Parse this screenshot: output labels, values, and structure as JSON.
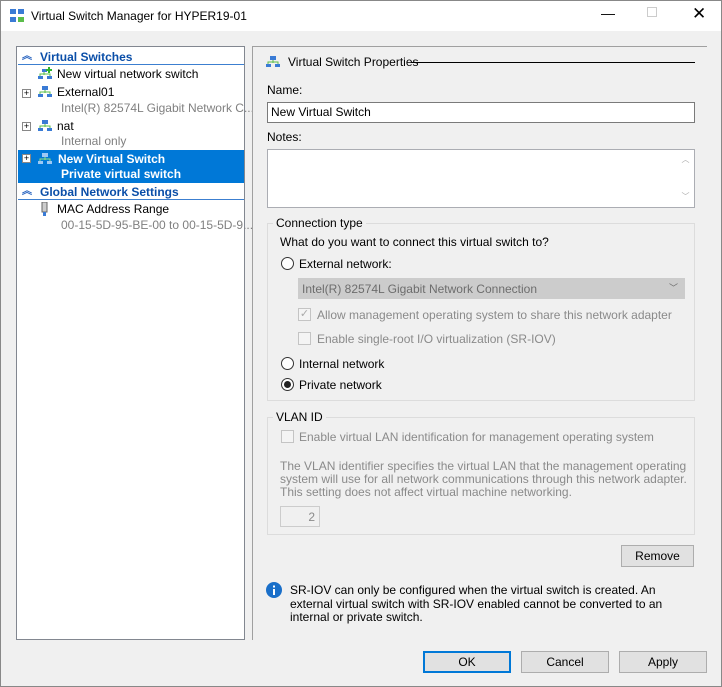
{
  "window": {
    "title": "Virtual Switch Manager for HYPER19-01"
  },
  "tree": {
    "virtual_switches_header": "Virtual Switches",
    "new_switch": "New virtual network switch",
    "switches": [
      {
        "name": "External01",
        "detail": "Intel(R) 82574L Gigabit Network C..."
      },
      {
        "name": "nat",
        "detail": "Internal only"
      },
      {
        "name": "New Virtual Switch",
        "detail": "Private virtual switch",
        "selected": true
      }
    ],
    "global_header": "Global Network Settings",
    "mac": {
      "name": "MAC Address Range",
      "detail": "00-15-5D-95-BE-00 to 00-15-5D-9..."
    }
  },
  "props": {
    "title": "Virtual Switch Properties",
    "name_label": "Name:",
    "name_value": "New Virtual Switch",
    "notes_label": "Notes:",
    "notes_value": "",
    "connection_type": "Connection type",
    "question": "What do you want to connect this virtual switch to?",
    "external": "External network:",
    "adapter": "Intel(R) 82574L Gigabit Network Connection",
    "allow_mgmt": "Allow management operating system to share this network adapter",
    "sriov": "Enable single-root I/O virtualization (SR-IOV)",
    "internal": "Internal network",
    "private": "Private network",
    "selected_type": "Private network",
    "vlan_title": "VLAN ID",
    "vlan_enable": "Enable virtual LAN identification for management operating system",
    "vlan_desc": "The VLAN identifier specifies the virtual LAN that the management operating system will use for all network communications through this network adapter. This setting does not affect virtual machine networking.",
    "vlan_value": "2",
    "remove": "Remove",
    "info": "SR-IOV can only be configured when the virtual switch is created. An external virtual switch with SR-IOV enabled cannot be converted to an internal or private switch."
  },
  "buttons": {
    "ok": "OK",
    "cancel": "Cancel",
    "apply": "Apply"
  },
  "colors": {
    "selection": "#0078d7",
    "header": "#0a4ea8"
  }
}
